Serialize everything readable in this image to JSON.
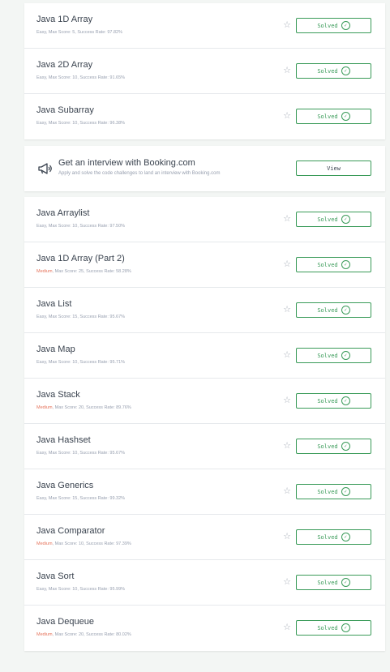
{
  "group1": [
    {
      "title": "Java 1D Array",
      "difficulty": "Easy",
      "meta": ", Max Score: 5, Success Rate: 97.82%",
      "status": "Solved"
    },
    {
      "title": "Java 2D Array",
      "difficulty": "Easy",
      "meta": ", Max Score: 10, Success Rate: 91.65%",
      "status": "Solved"
    },
    {
      "title": "Java Subarray",
      "difficulty": "Easy",
      "meta": ", Max Score: 10, Success Rate: 96.38%",
      "status": "Solved"
    }
  ],
  "promo": {
    "icon": "megaphone-icon",
    "title": "Get an interview with Booking.com",
    "subtitle": "Apply and solve the code challenges to land an interview with Booking.com",
    "button": "View"
  },
  "group2": [
    {
      "title": "Java Arraylist",
      "difficulty": "Easy",
      "meta": ", Max Score: 10, Success Rate: 97.50%",
      "status": "Solved"
    },
    {
      "title": "Java 1D Array (Part 2)",
      "difficulty": "Medium",
      "meta": ", Max Score: 25, Success Rate: 58.28%",
      "status": "Solved"
    },
    {
      "title": "Java List",
      "difficulty": "Easy",
      "meta": ", Max Score: 15, Success Rate: 95.67%",
      "status": "Solved"
    },
    {
      "title": "Java Map",
      "difficulty": "Easy",
      "meta": ", Max Score: 10, Success Rate: 95.71%",
      "status": "Solved"
    },
    {
      "title": "Java Stack",
      "difficulty": "Medium",
      "meta": ", Max Score: 20, Success Rate: 89.76%",
      "status": "Solved"
    },
    {
      "title": "Java Hashset",
      "difficulty": "Easy",
      "meta": ", Max Score: 10, Success Rate: 95.67%",
      "status": "Solved"
    },
    {
      "title": "Java Generics",
      "difficulty": "Easy",
      "meta": ", Max Score: 15, Success Rate: 99.32%",
      "status": "Solved"
    },
    {
      "title": "Java Comparator",
      "difficulty": "Medium",
      "meta": ", Max Score: 10, Success Rate: 97.39%",
      "status": "Solved"
    },
    {
      "title": "Java Sort",
      "difficulty": "Easy",
      "meta": ", Max Score: 10, Success Rate: 95.99%",
      "status": "Solved"
    },
    {
      "title": "Java Dequeue",
      "difficulty": "Medium",
      "meta": ", Max Score: 20, Success Rate: 80.02%",
      "status": "Solved"
    }
  ],
  "colors": {
    "accent": "#3a9b59",
    "medium": "#e5725a",
    "text": "#39424e",
    "muted": "#979faf"
  }
}
